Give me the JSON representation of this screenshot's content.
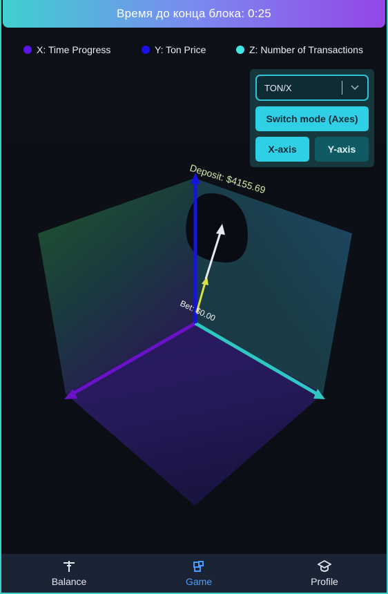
{
  "header": {
    "timer_text": "Время до конца блока: 0:25"
  },
  "legend": [
    {
      "label": "X: Time Progress",
      "color": "#5a14e0"
    },
    {
      "label": "Y: Ton Price",
      "color": "#1a10e8"
    },
    {
      "label": "Z: Number of Transactions",
      "color": "#3fe6e6"
    }
  ],
  "controls": {
    "pair_value": "TON/X",
    "switch_label": "Switch mode (Axes)",
    "x_axis_label": "X-axis",
    "y_axis_label": "Y-axis"
  },
  "scene": {
    "deposit_label": "Deposit: $4155.69",
    "bet_label": "Bet: $0.00",
    "axis_colors": {
      "x": "#6a12c8",
      "y": "#1414dd",
      "z": "#2ec7c4"
    }
  },
  "tabbar": {
    "tabs": [
      {
        "label": "Balance",
        "icon": "balance-icon",
        "active": false
      },
      {
        "label": "Game",
        "icon": "game-icon",
        "active": true
      },
      {
        "label": "Profile",
        "icon": "profile-icon",
        "active": false
      }
    ]
  }
}
